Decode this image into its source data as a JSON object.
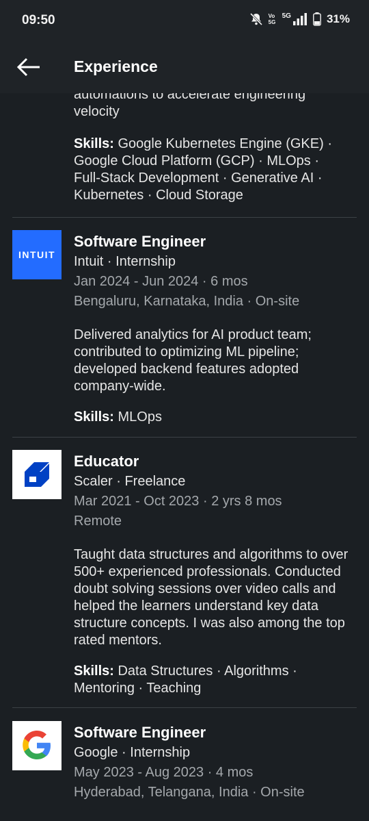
{
  "status": {
    "time": "09:50",
    "battery": "31%",
    "network": "5G",
    "volte": "Vo 5G"
  },
  "header": {
    "title": "Experience"
  },
  "top": {
    "description": "automations to accelerate engineering velocity",
    "skills_label": "Skills:",
    "skills": "Google Kubernetes Engine (GKE) · Google Cloud Platform (GCP) · MLOps · Full-Stack Development · Generative AI · Kubernetes · Cloud Storage"
  },
  "experiences": [
    {
      "title": "Software Engineer",
      "company": "Intuit · Internship",
      "dates": "Jan 2024 - Jun 2024 · 6 mos",
      "location": "Bengaluru, Karnataka, India · On-site",
      "description": "Delivered analytics for AI product team; contributed to optimizing ML pipeline; developed backend features adopted company-wide.",
      "skills_label": "Skills:",
      "skills": "MLOps",
      "logo_text": "INTUIT",
      "logo_color": "#236cff"
    },
    {
      "title": "Educator",
      "company": "Scaler · Freelance",
      "dates": "Mar 2021 - Oct 2023 · 2 yrs 8 mos",
      "location": "Remote",
      "description": "Taught data structures and algorithms to over 500+ experienced professionals. Conducted doubt solving sessions over video calls and helped the learners understand key data structure concepts. I was also among the top rated mentors.",
      "skills_label": "Skills:",
      "skills": "Data Structures · Algorithms · Mentoring · Teaching",
      "logo_color": "#0041c4"
    },
    {
      "title": "Software Engineer",
      "company": "Google · Internship",
      "dates": "May 2023 - Aug 2023 · 4 mos",
      "location": "Hyderabad, Telangana, India · On-site"
    }
  ]
}
